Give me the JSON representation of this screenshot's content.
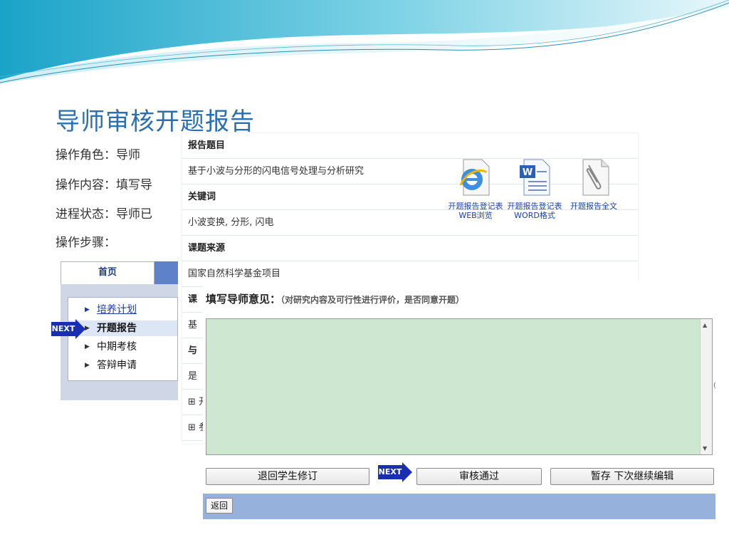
{
  "slide": {
    "title": "导师审核开题报告",
    "info": [
      "操作角色：导师",
      "操作内容：填写导",
      "进程状态：导师已",
      "操作步骤："
    ]
  },
  "nav": {
    "tab": "首页",
    "items": [
      {
        "label": "培养计划",
        "link": true
      },
      {
        "label": "开题报告",
        "active": true
      },
      {
        "label": "中期考核"
      },
      {
        "label": "答辩申请"
      }
    ],
    "next_badge": "NEXT"
  },
  "report": {
    "rows": [
      {
        "kind": "head",
        "text": "报告题目"
      },
      {
        "kind": "val",
        "text": "基于小波与分形的闪电信号处理与分析研究"
      },
      {
        "kind": "head",
        "text": "关键词"
      },
      {
        "kind": "val",
        "text": "小波变换, 分形, 闪电"
      },
      {
        "kind": "head",
        "text": "课题来源"
      },
      {
        "kind": "val",
        "text": "国家自然科学基金项目"
      },
      {
        "kind": "head",
        "text": "课"
      },
      {
        "kind": "val",
        "text": "基"
      },
      {
        "kind": "head",
        "text": "与"
      },
      {
        "kind": "val",
        "text": "是"
      },
      {
        "kind": "val",
        "text": "⊞ 开"
      },
      {
        "kind": "val",
        "text": "⊞ 参"
      }
    ],
    "files": [
      {
        "icon": "ie-browser-icon",
        "caption": "开题报告登记表WEB浏览"
      },
      {
        "icon": "word-document-icon",
        "caption": "开题报告登记表WORD格式"
      },
      {
        "icon": "attachment-icon",
        "caption": "开题报告全文"
      }
    ]
  },
  "opinion": {
    "title": "填写导师意见：",
    "hint": "（对研究内容及可行性进行评价，是否同意开题）",
    "text": "",
    "buttons": {
      "return": "退回学生修订",
      "approve": "审核通过",
      "save": "暂存 下次继续编辑"
    },
    "next_badge": "NEXT",
    "back": "返回"
  },
  "colors": {
    "title": "#2a6fb0",
    "textarea": "#cde7d0",
    "footer": "#96b2dc",
    "next": "#1a2fb0"
  }
}
